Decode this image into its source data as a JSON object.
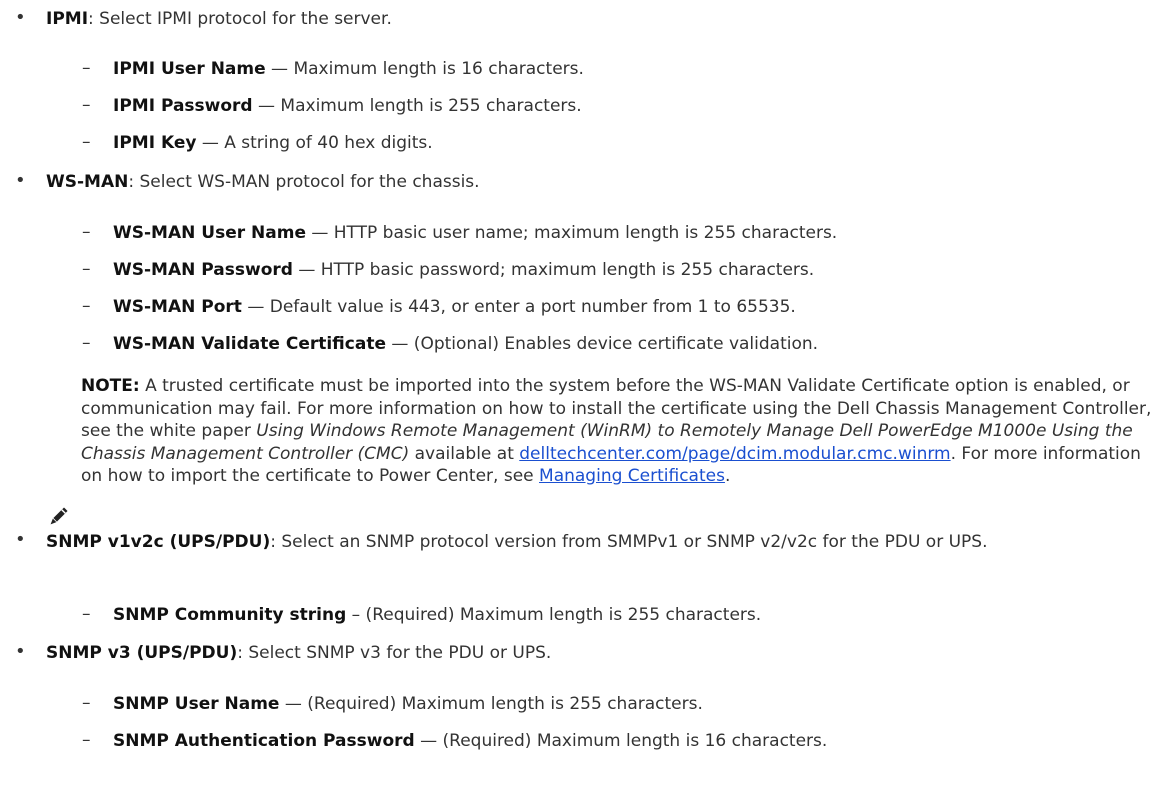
{
  "ipmi": {
    "term": "IPMI",
    "desc": ": Select IPMI protocol for the server.",
    "items": [
      {
        "term": "IPMI User Name",
        "desc": " — Maximum length is 16 characters."
      },
      {
        "term": "IPMI Password",
        "desc": " — Maximum length is 255 characters."
      },
      {
        "term": "IPMI Key",
        "desc": " — A string of 40 hex digits."
      }
    ]
  },
  "wsman": {
    "term": "WS-MAN",
    "desc": ": Select WS-MAN protocol for the chassis.",
    "items": [
      {
        "term": "WS-MAN User Name",
        "desc": " — HTTP basic user name; maximum length is 255 characters."
      },
      {
        "term": "WS-MAN Password",
        "desc": " — HTTP basic password; maximum length is 255 characters."
      },
      {
        "term": "WS-MAN Port",
        "desc": " — Default value is 443, or enter a port number from 1 to 65535."
      },
      {
        "term": "WS-MAN Validate Certificate",
        "desc": " — (Optional) Enables device certificate validation."
      }
    ]
  },
  "note": {
    "label": "NOTE:",
    "text1": " A trusted certificate must be imported into the system before the WS-MAN Validate Certificate option is enabled, or communication may fail. For more information on how to install the certificate using the Dell Chassis Management Controller, see the white paper ",
    "paper_title": "Using Windows Remote Management (WinRM) to Remotely Manage Dell PowerEdge M1000e Using the Chassis Management Controller (CMC)",
    "text2": " available at ",
    "link1": "delltechcenter.com/page/dcim.modular.cmc.winrm",
    "text3": ". For more information on how to import the certificate to Power Center, see ",
    "link2": "Managing Certificates",
    "text4": "."
  },
  "snmp12": {
    "term": "SNMP v1v2c (UPS/PDU)",
    "desc": ": Select an SNMP protocol version from SMMPv1 or SNMP v2/v2c for the PDU or UPS.",
    "items": [
      {
        "term": "SNMP Community string",
        "desc": " – (Required) Maximum length is 255 characters."
      }
    ]
  },
  "snmp3": {
    "term": "SNMP v3 (UPS/PDU)",
    "desc": ": Select SNMP v3 for the PDU or UPS.",
    "items": [
      {
        "term": "SNMP User Name",
        "desc": " — (Required) Maximum length is 255 characters."
      },
      {
        "term": "SNMP Authentication Password",
        "desc": " — (Required) Maximum length is 16 characters."
      }
    ]
  }
}
